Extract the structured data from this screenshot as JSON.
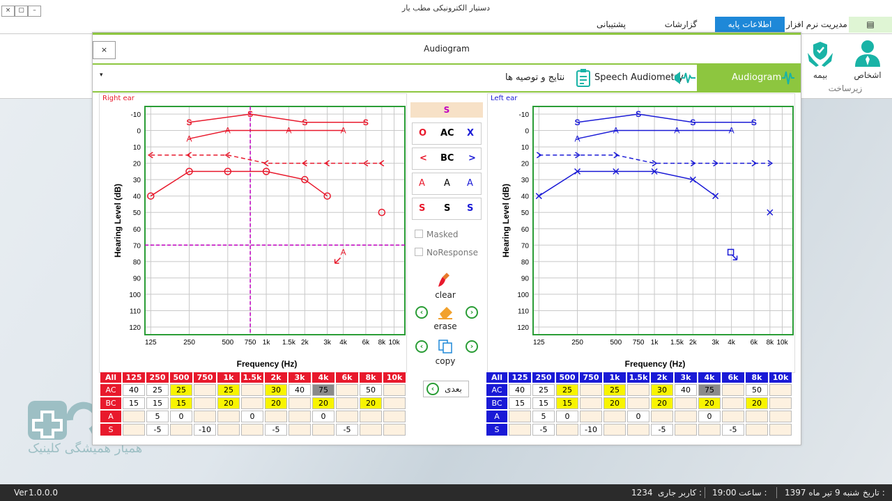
{
  "window": {
    "title": "دستیار الکترونیکی مطب یار",
    "btn_close": "×",
    "btn_max": "▢",
    "btn_min": "–"
  },
  "menu": {
    "app": "مدیریت نرم افزار",
    "basic_info": "اطلاعات پایه",
    "reports": "گزارشات",
    "support": "پشتیبانی"
  },
  "ribbon": {
    "persons": "اشخاص",
    "insurance": "بیمه",
    "group": "زیرساخت"
  },
  "dialog": {
    "title": "Audiogram",
    "close": "×",
    "dropdown": "▾"
  },
  "tabs": {
    "audiogram": "Audiogram",
    "speech": "Speech Audiometry",
    "results": "نتایج و توصیه ها"
  },
  "charts": {
    "right": {
      "title": "Right ear",
      "xlabel": "Frequency (Hz)",
      "ylabel": "Hearing Level (dB)"
    },
    "left": {
      "title": "Left ear",
      "xlabel": "Frequency (Hz)",
      "ylabel": "Hearing Level (dB)"
    }
  },
  "chart_data": [
    {
      "type": "line",
      "title": "Right ear",
      "xlabel": "Frequency (Hz)",
      "ylabel": "Hearing Level (dB)",
      "xticks": [
        "125",
        "250",
        "500",
        "750",
        "1k",
        "1.5k",
        "2k",
        "3k",
        "4k",
        "6k",
        "8k",
        "10k"
      ],
      "yticks": [
        -10,
        0,
        10,
        20,
        30,
        40,
        50,
        60,
        70,
        80,
        90,
        100,
        110,
        120
      ],
      "ylim": [
        -10,
        120
      ],
      "series": [
        {
          "name": "AC",
          "values": [
            40,
            25,
            25,
            null,
            25,
            null,
            30,
            40,
            null,
            null,
            50,
            null
          ]
        },
        {
          "name": "BC",
          "values": [
            15,
            15,
            15,
            null,
            20,
            null,
            20,
            20,
            null,
            20,
            20,
            null
          ]
        },
        {
          "name": "A",
          "values": [
            null,
            5,
            0,
            null,
            null,
            0,
            null,
            null,
            0,
            null,
            null,
            null
          ]
        },
        {
          "name": "S",
          "values": [
            null,
            -5,
            null,
            -10,
            null,
            null,
            -5,
            null,
            null,
            -5,
            null,
            null
          ]
        }
      ],
      "cursor": {
        "freq": "750",
        "level": 70
      }
    },
    {
      "type": "line",
      "title": "Left ear",
      "xlabel": "Frequency (Hz)",
      "ylabel": "Hearing Level (dB)",
      "xticks": [
        "125",
        "250",
        "500",
        "750",
        "1k",
        "1.5k",
        "2k",
        "3k",
        "4k",
        "6k",
        "8k",
        "10k"
      ],
      "yticks": [
        -10,
        0,
        10,
        20,
        30,
        40,
        50,
        60,
        70,
        80,
        90,
        100,
        110,
        120
      ],
      "ylim": [
        -10,
        120
      ],
      "series": [
        {
          "name": "AC",
          "values": [
            40,
            25,
            25,
            null,
            25,
            null,
            30,
            40,
            null,
            null,
            50,
            null
          ]
        },
        {
          "name": "BC",
          "values": [
            15,
            15,
            15,
            null,
            20,
            null,
            20,
            20,
            null,
            20,
            20,
            null
          ]
        },
        {
          "name": "A",
          "values": [
            null,
            5,
            0,
            null,
            null,
            0,
            null,
            null,
            0,
            null,
            null,
            null
          ]
        },
        {
          "name": "S",
          "values": [
            null,
            -5,
            null,
            -10,
            null,
            null,
            -5,
            null,
            null,
            -5,
            null,
            null
          ]
        }
      ]
    }
  ],
  "panel": {
    "s_header": "S",
    "ac": {
      "r": "O",
      "label": "AC",
      "l": "X"
    },
    "bc": {
      "r": "<",
      "label": "BC",
      "l": ">"
    },
    "a": {
      "r": "A",
      "label": "A",
      "l": "A"
    },
    "s": {
      "r": "S",
      "label": "S",
      "l": "S"
    },
    "masked": "Masked",
    "noresponse": "NoResponse",
    "clear": "clear",
    "erase": "erase",
    "copy": "copy",
    "next": "بعدی"
  },
  "table": {
    "headers": [
      "All",
      "125",
      "250",
      "500",
      "750",
      "1k",
      "1.5k",
      "2k",
      "3k",
      "4k",
      "6k",
      "8k",
      "10k"
    ],
    "rows": [
      {
        "label": "AC",
        "cells": [
          "40",
          "25",
          "25",
          "",
          "25",
          "",
          "30",
          "40",
          "75",
          "",
          "50",
          ""
        ]
      },
      {
        "label": "BC",
        "cells": [
          "15",
          "15",
          "15",
          "",
          "20",
          "",
          "20",
          "",
          "20",
          "",
          "20",
          ""
        ]
      },
      {
        "label": "A",
        "cells": [
          "",
          "5",
          "0",
          "",
          "",
          "0",
          "",
          "",
          "0",
          "",
          "",
          ""
        ]
      },
      {
        "label": "S",
        "cells": [
          "",
          "-5",
          "",
          "-10",
          "",
          "",
          "-5",
          "",
          "",
          "-5",
          "",
          ""
        ]
      }
    ]
  },
  "watermark": "همیار همیشگی کلینیک",
  "status": {
    "date_label": "تاریخ :",
    "date": "1397 شنبه 9 تیر ماه",
    "time_label": "ساعت :",
    "time": "19:00",
    "user_label": "کاربر جاری :",
    "user": "1234",
    "ver_label": "Ver",
    "ver": "1.0.0.0"
  },
  "colors": {
    "right": "#e8192c",
    "left": "#1a1ad6",
    "accent": "#8dc63f",
    "menu_active": "#1e88d8"
  }
}
